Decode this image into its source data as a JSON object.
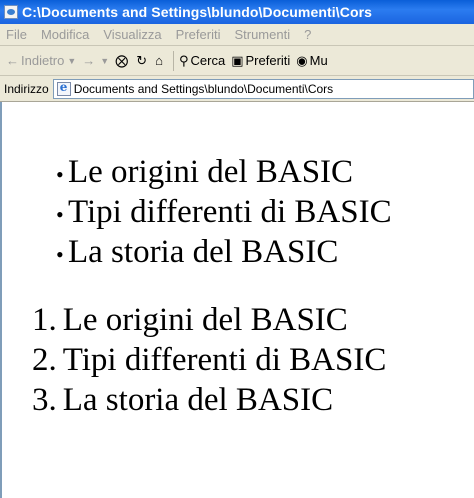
{
  "window": {
    "title": "C:\\Documents and Settings\\blundo\\Documenti\\Cors"
  },
  "menu": {
    "items": [
      "File",
      "Modifica",
      "Visualizza",
      "Preferiti",
      "Strumenti",
      "?"
    ]
  },
  "toolbar": {
    "back_label": "Indietro",
    "search_label": "Cerca",
    "favorites_label": "Preferiti",
    "media_label": "Mu"
  },
  "address": {
    "label": "Indirizzo",
    "value": "Documents and Settings\\blundo\\Documenti\\Cors"
  },
  "content": {
    "bullet_items": [
      "Le origini del BASIC",
      "Tipi differenti di BASIC",
      "La storia del BASIC"
    ],
    "numbered_items": [
      "Le origini del BASIC",
      "Tipi differenti di BASIC",
      "La storia del BASIC"
    ]
  },
  "colors": {
    "titlebar": "#0a5fd8",
    "chrome": "#ece9d8",
    "disabled_text": "#9a9a9a"
  }
}
